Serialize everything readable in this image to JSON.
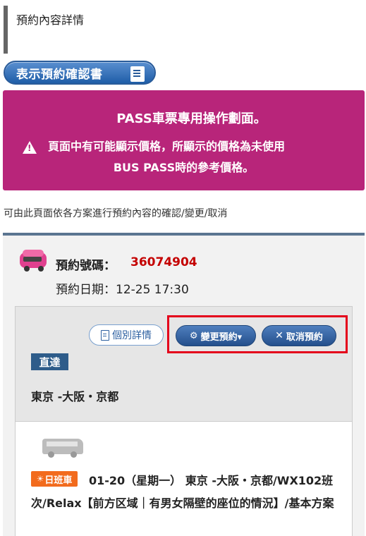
{
  "header": {
    "title": "預約內容詳情"
  },
  "confirm_button": {
    "label": "表示預約確認書"
  },
  "banner": {
    "headline": "PASS車票專用操作劃面。",
    "warning_line1": "頁面中有可能顯示價格，所顯示的價格為未使用",
    "warning_line2": "BUS PASS時的參考價格。"
  },
  "intro_text": "可由此頁面依各方案進行預約內容的確認/變更/取消",
  "reservation": {
    "number_label": "預約號碼：",
    "number": "36074904",
    "date": "預約日期：12-25 17:30",
    "buttons": {
      "details": "個別詳情",
      "change": "變更預約▾",
      "cancel": "取消預約"
    },
    "direct_label": "直達",
    "route": "東京 -大阪・京都",
    "trip": {
      "badge": "日班車",
      "description": "01-20（星期一） 東京 -大阪・京都/WX102班次/Relax【前方区域｜有男女隔壁的座位的情況】/基本方案"
    }
  },
  "colors": {
    "banner_bg": "#b8257a",
    "reservation_number": "#c40000",
    "highlight_border": "#e4001b",
    "button_blue": "#244f8c",
    "badge_orange": "#f26b1d"
  }
}
